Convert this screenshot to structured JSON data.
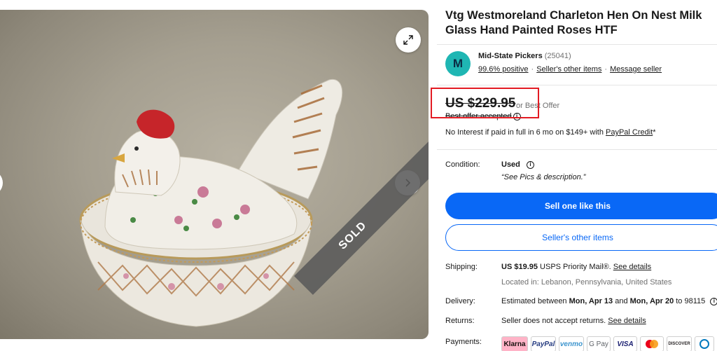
{
  "listing": {
    "title": "Vtg Westmoreland Charleton Hen On Nest Milk Glass Hand Painted Roses HTF",
    "ribbon": "SOLD"
  },
  "seller": {
    "initial": "M",
    "name": "Mid-State Pickers",
    "feedback_count": "(25041)",
    "positive": "99.6% positive",
    "other_items_link": "Seller's other items",
    "message_link": "Message seller"
  },
  "pricing": {
    "price": "US $229.95",
    "best_offer": "or Best Offer",
    "offer_accepted": "Best offer accepted",
    "credit_prefix": "No Interest if paid in full in 6 mo on $149+ with ",
    "credit_link": "PayPal Credit",
    "credit_suffix": "*"
  },
  "details": {
    "condition_label": "Condition:",
    "condition_value": "Used",
    "condition_note": "“See Pics & description.”",
    "shipping_label": "Shipping:",
    "shipping_price": "US $19.95",
    "shipping_service": "USPS Priority Mail®.",
    "shipping_link": "See details",
    "location": "Located in: Lebanon, Pennsylvania, United States",
    "delivery_label": "Delivery:",
    "delivery_prefix": "Estimated between ",
    "delivery_from": "Mon, Apr 13",
    "delivery_and": " and ",
    "delivery_to": "Mon, Apr 20",
    "delivery_suffix": " to 98115",
    "returns_label": "Returns:",
    "returns_text": "Seller does not accept returns.",
    "returns_link": "See details",
    "payments_label": "Payments:"
  },
  "actions": {
    "sell_one": "Sell one like this",
    "other_items": "Seller's other items"
  },
  "payments": [
    "Klarna",
    "PayPal",
    "venmo",
    "G Pay",
    "VISA",
    "",
    "DISCOVER",
    ""
  ],
  "colors": {
    "primary_button": "#0968f6",
    "highlight": "#e31b23",
    "avatar": "#1fb6b3"
  },
  "icons": {
    "expand": "expand-icon",
    "next": "chevron-right-icon",
    "info": "info-icon"
  }
}
